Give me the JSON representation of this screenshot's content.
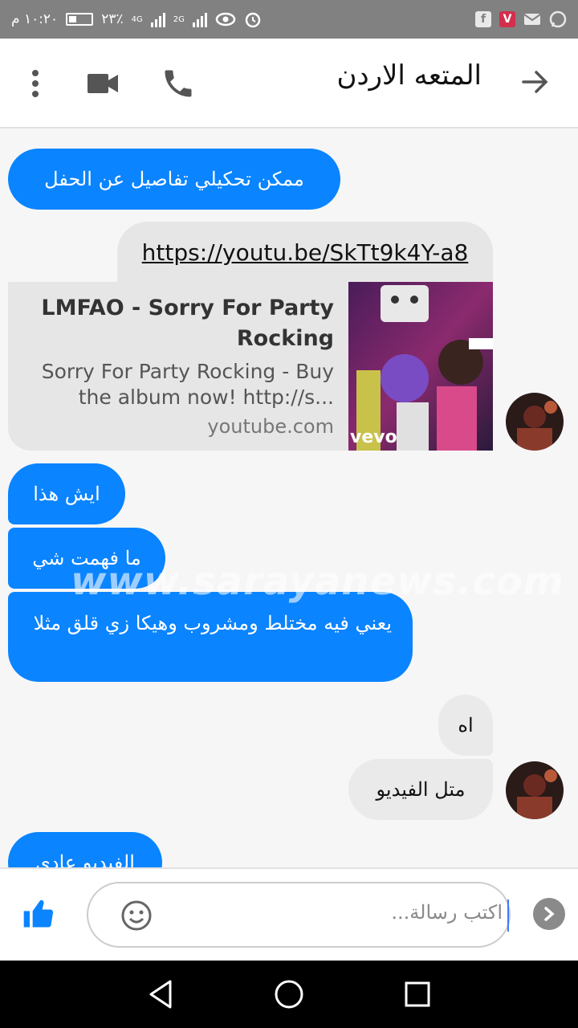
{
  "status_bar": {
    "time": "١٠:٢٠ م",
    "battery": "٢٣٪",
    "net1": "4G",
    "net2": "2G",
    "notif_icons": [
      "facebook-icon",
      "v-app-icon",
      "mail-icon",
      "whatsapp-icon"
    ]
  },
  "header": {
    "title": "المتعه الاردن",
    "icons": [
      "more-vert-icon",
      "video-call-icon",
      "phone-icon",
      "back-arrow-icon"
    ]
  },
  "messages": [
    {
      "side": "received",
      "text": "ممكن تحكيلي تفاصيل عن الحفل"
    },
    {
      "side": "sent",
      "text": "https://youtu.be/SkTt9k4Y-a8"
    },
    {
      "side": "sent_card",
      "title": "LMFAO - Sorry For Party Rocking",
      "desc": "Sorry For Party Rocking - Buy the album now! http://s...",
      "domain": "youtube.com",
      "thumb_label": "vevo"
    },
    {
      "side": "received",
      "text": "ايش هذا"
    },
    {
      "side": "received",
      "text": "ما فهمت شي"
    },
    {
      "side": "received",
      "text": "يعني فيه مختلط ومشروب وهيكا زي قلق مثلا"
    },
    {
      "side": "sent",
      "text": "اه"
    },
    {
      "side": "sent",
      "text": "متل الفيديو"
    },
    {
      "side": "received",
      "text": "الفيديو عادي"
    }
  ],
  "watermark": "www.sarayanews.com",
  "composer": {
    "placeholder": "اكتب رسالة...",
    "icons": [
      "like-icon",
      "emoji-icon",
      "send-chevron-icon"
    ]
  },
  "colors": {
    "accent": "#0a84ff",
    "status_bar": "#818181",
    "incoming_bubble": "#eaeaea"
  }
}
